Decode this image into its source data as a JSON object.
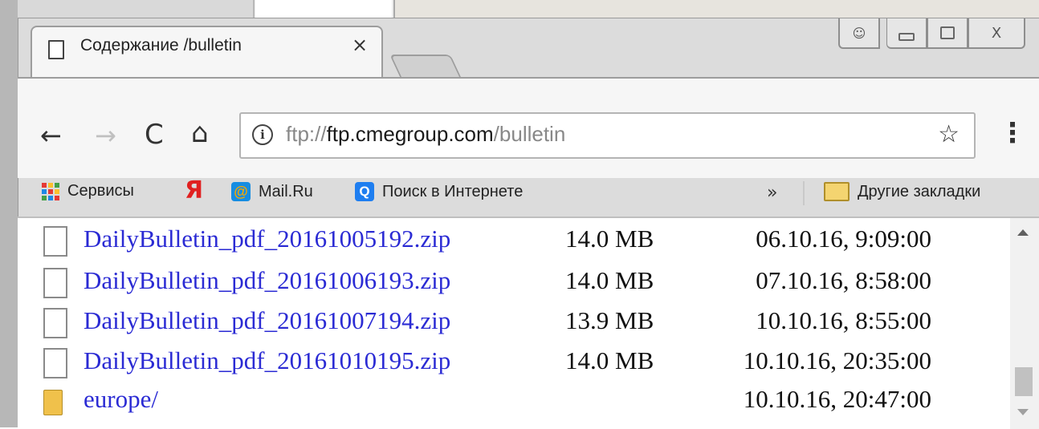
{
  "tab": {
    "title": "Содержание /bulletin",
    "close_glyph": "×"
  },
  "window_controls": {
    "user": "👤",
    "minimize": "",
    "maximize": "",
    "close": "X"
  },
  "nav": {
    "back": "←",
    "forward": "→",
    "reload": "C",
    "home": "⌂"
  },
  "omnibox": {
    "scheme": "ftp://",
    "host": "ftp.cmegroup.com",
    "path": "/bulletin",
    "info_glyph": "i",
    "star": "☆"
  },
  "menu_glyph": "⋮",
  "bookmarks": {
    "apps": "Сервисы",
    "yandex_glyph": "Я",
    "mail": "Mail.Ru",
    "mail_glyph": "@",
    "search": "Поиск в Интернете",
    "search_glyph": "Q",
    "overflow": "»",
    "other": "Другие закладки"
  },
  "files": [
    {
      "name": "DailyBulletin_pdf_20161005192.zip",
      "size": "14.0 MB",
      "date": "06.10.16, 9:09:00",
      "type": "file"
    },
    {
      "name": "DailyBulletin_pdf_20161006193.zip",
      "size": "14.0 MB",
      "date": "07.10.16, 8:58:00",
      "type": "file"
    },
    {
      "name": "DailyBulletin_pdf_20161007194.zip",
      "size": "13.9 MB",
      "date": "10.10.16, 8:55:00",
      "type": "file"
    },
    {
      "name": "DailyBulletin_pdf_20161010195.zip",
      "size": "14.0 MB",
      "date": "10.10.16, 20:35:00",
      "type": "file"
    },
    {
      "name": "europe/",
      "size": "",
      "date": "10.10.16, 20:47:00",
      "type": "dir"
    }
  ],
  "colors": {
    "link": "#2b2bd4",
    "chrome": "#f6f6f6",
    "yandex": "#e02020"
  }
}
